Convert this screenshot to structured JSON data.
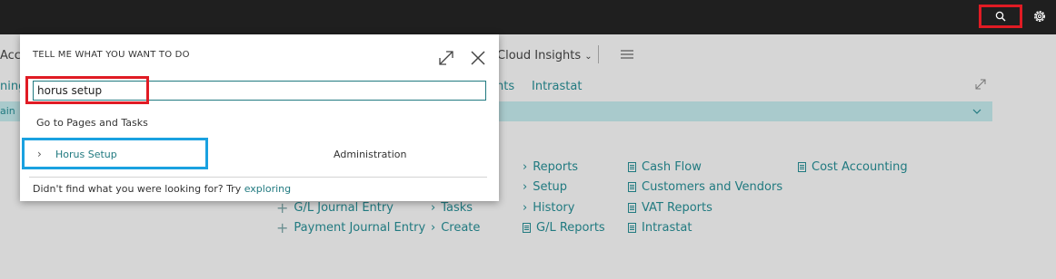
{
  "topbar": {
    "search_icon": "search-icon",
    "settings_icon": "gear-icon"
  },
  "background": {
    "nav_partial_left": "Acco",
    "nav_cloud_insights": "Cloud Insights",
    "actions_partial_left": "ning",
    "actions_partial_ents": "nts",
    "action_intrastat": "Intrastat",
    "bar_label": "ain",
    "columns": {
      "col_a": [
        "G/L Journal Entry",
        "Payment Journal Entry"
      ],
      "col_b_top": [
        "Reports",
        "Setup",
        "History"
      ],
      "col_b_bottom": [
        "Tasks",
        "Create"
      ],
      "col_b_reports": "G/L Reports",
      "col_c": [
        "Cash Flow",
        "Customers and Vendors",
        "VAT Reports",
        "Intrastat"
      ],
      "col_d": [
        "Cost Accounting"
      ]
    }
  },
  "dialog": {
    "title": "TELL ME WHAT YOU WANT TO DO",
    "search_value": "horus setup",
    "group_heading": "Go to Pages and Tasks",
    "result_label": "Horus Setup",
    "result_category": "Administration",
    "footer_text": "Didn't find what you were looking for? Try ",
    "footer_link": "exploring"
  },
  "colors": {
    "accent": "#217a80",
    "highlight_red": "#e01b24",
    "highlight_blue": "#1aa1e0"
  }
}
